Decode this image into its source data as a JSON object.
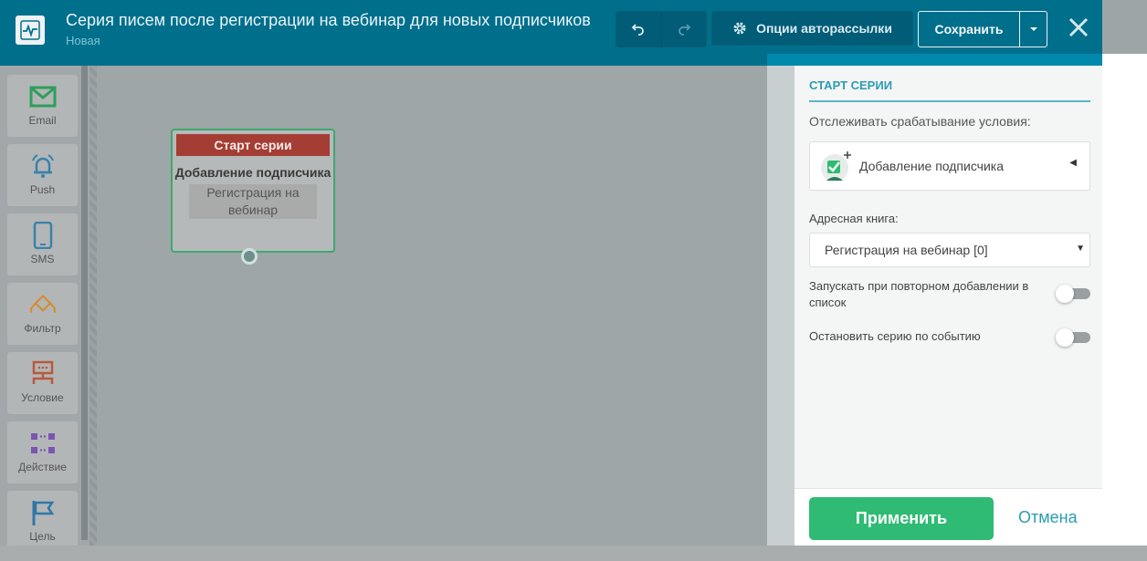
{
  "header": {
    "title": "Серия писем после регистрации на вебинар для новых подписчиков",
    "status": "Новая",
    "undo_icon": "undo-icon",
    "redo_icon": "redo-icon",
    "options_label": "Опции авторассылки",
    "save_label": "Сохранить",
    "close_icon": "close-icon"
  },
  "palette": {
    "items": [
      {
        "label": "Email",
        "icon": "envelope-icon"
      },
      {
        "label": "Push",
        "icon": "bell-icon"
      },
      {
        "label": "SMS",
        "icon": "phone-icon"
      },
      {
        "label": "Фильтр",
        "icon": "filter-icon"
      },
      {
        "label": "Условие",
        "icon": "condition-icon"
      },
      {
        "label": "Действие",
        "icon": "action-icon"
      },
      {
        "label": "Цель",
        "icon": "flag-icon"
      }
    ]
  },
  "canvas": {
    "node": {
      "header": "Старт серии",
      "title": "Добавление подписчика",
      "subtitle": "Регистрация на вебинар"
    }
  },
  "panel": {
    "heading": "СТАРТ СЕРИИ",
    "track_label": "Отслеживать срабатывание условия:",
    "condition_value": "Добавление подписчика",
    "address_book_label": "Адресная книга:",
    "address_book_value": "Регистрация на вебинар [0]",
    "rerun_label": "Запускать при повторном добавлении в список",
    "rerun_on": false,
    "stop_label": "Остановить серию по событию",
    "stop_on": false,
    "apply_label": "Применить",
    "cancel_label": "Отмена"
  },
  "colors": {
    "header_bg": "#006f8c",
    "accent": "#2fbb73",
    "node_header": "#a43e35",
    "link": "#2a9cb5"
  }
}
